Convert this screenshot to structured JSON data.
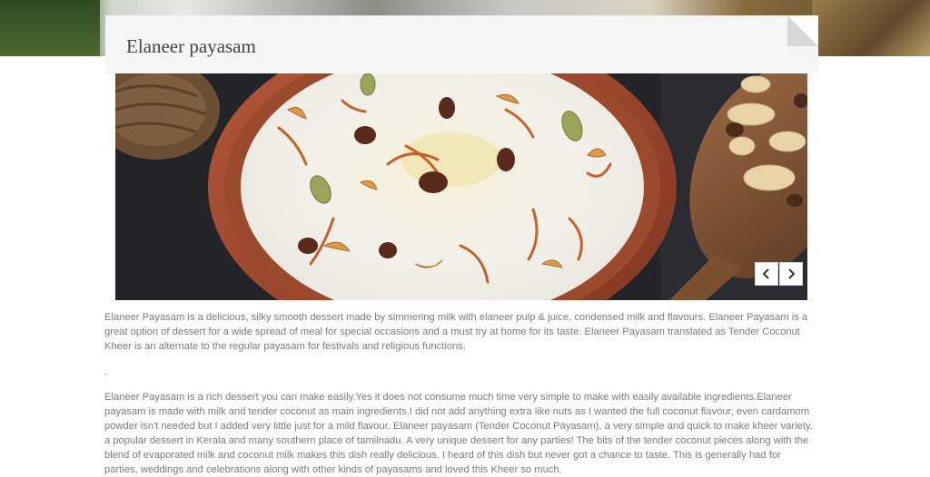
{
  "page": {
    "title": "Elaneer payasam"
  },
  "slider": {
    "image_alt": "Elaneer payasam in a clay bowl topped with fried cashews, raisins and cardamom",
    "prev_icon": "chevron-left-icon",
    "next_icon": "chevron-right-icon"
  },
  "content": {
    "paragraph1": "Elaneer Payasam is a delicious, silky smooth dessert made by simmering milk with elaneer pulp & juice, condensed milk and flavours. Elaneer Payasam is a great option of dessert for a wide spread of meal for special occasions and a must try at home for its taste. Elaneer Payasam translated as Tender Coconut Kheer is an alternate to the regular payasam for festivals and religious functions.",
    "paragraph2": ".",
    "paragraph3": "Elaneer Payasam is a rich dessert you can make easily.Yes it does not consume much time very simple to make with easily available ingredients.Elaneer payasam is made with milk and tender coconut as main ingredients.I did not add anything extra like nuts as I wanted the full coconut flavour, even cardamom powder isn't needed but I added very little just for a mild flavour. Elaneer payasam (Tender Coconut Payasam), a very simple and quick to make kheer variety. a popular dessert in Kerala and many southern place of tamilnadu. A very unique dessert for any parties! The bits of the tender coconut pieces along with the blend of evaporated milk and coconut milk makes this dish really delicious. I heard of this dish but never got a chance to taste. This is generally had for parties, weddings and celebrations along with other kinds of payasams and loved this Kheer so much."
  },
  "colors": {
    "card_bg": "#f5f5f5",
    "title_text": "#444444",
    "body_text": "#7a7a7a"
  }
}
